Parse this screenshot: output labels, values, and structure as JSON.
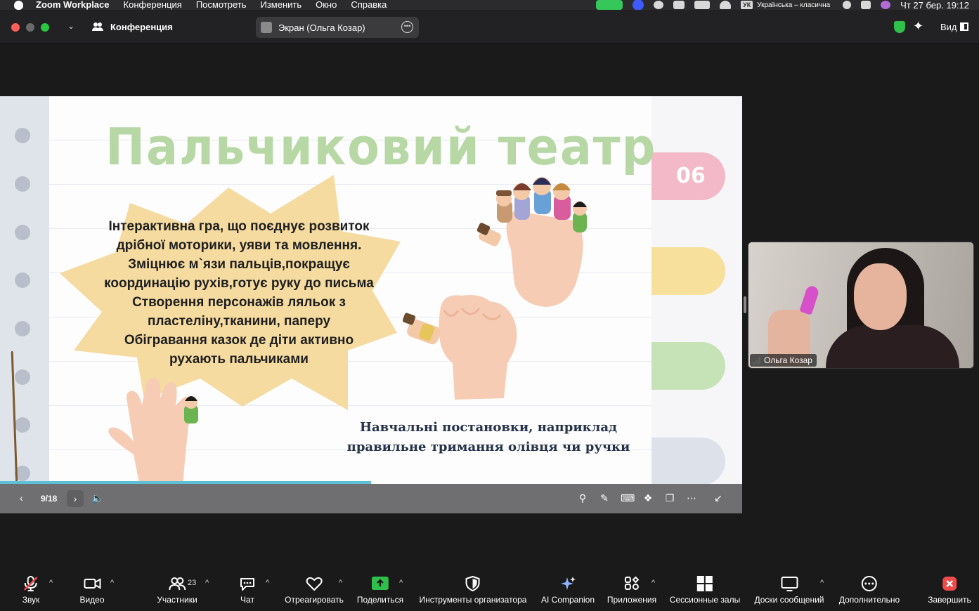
{
  "menubar": {
    "app_name": "Zoom Workplace",
    "items": [
      "Конференция",
      "Посмотреть",
      "Изменить",
      "Окно",
      "Справка"
    ],
    "keyboard_badge": "УК",
    "keyboard_layout": "Українська – класична",
    "clock": "Чт 27 бер.  19:12"
  },
  "titlebar": {
    "meeting_label": "Конференция",
    "screen_tab": "Экран (Ольга Козар)",
    "view_label": "Вид"
  },
  "slide": {
    "title": "Пальчиковий театр",
    "tab_number": "06",
    "burst_lines": [
      "Інтерактивна гра, що поєднує розвиток",
      "дрібної моторики, уяви та мовлення.",
      "Зміцнює м`язи пальців,покращує",
      "координацію рухів,готує руку до письма",
      "Створення персонажів ляльок  з",
      "пластеліну,тканини, паперу",
      "Обігравання казок  де діти активно",
      "рухають пальчиками"
    ],
    "caption_lines": [
      "Навчальні постановки, наприклад",
      "правильне тримання олівця чи ручки"
    ]
  },
  "slide_bar": {
    "page": "9/18",
    "progress": 0.5
  },
  "video": {
    "participant_name": "Ольга Козар"
  },
  "toolbar": {
    "audio": "Звук",
    "video": "Видео",
    "participants": "Участники",
    "participants_count": "23",
    "chat": "Чат",
    "react": "Отреагировать",
    "share": "Поделиться",
    "host_tools": "Инструменты организатора",
    "ai": "AI Companion",
    "apps": "Приложения",
    "breakout": "Сессионные залы",
    "whiteboards": "Доски сообщений",
    "more": "Дополнительно",
    "end": "Завершить"
  },
  "colors": {
    "title_green": "#b7d8a4",
    "burst_yellow": "#f5dba0",
    "share_green": "#2fc04b",
    "end_red": "#f04a4a",
    "progress_cyan": "#5ec0d4"
  }
}
